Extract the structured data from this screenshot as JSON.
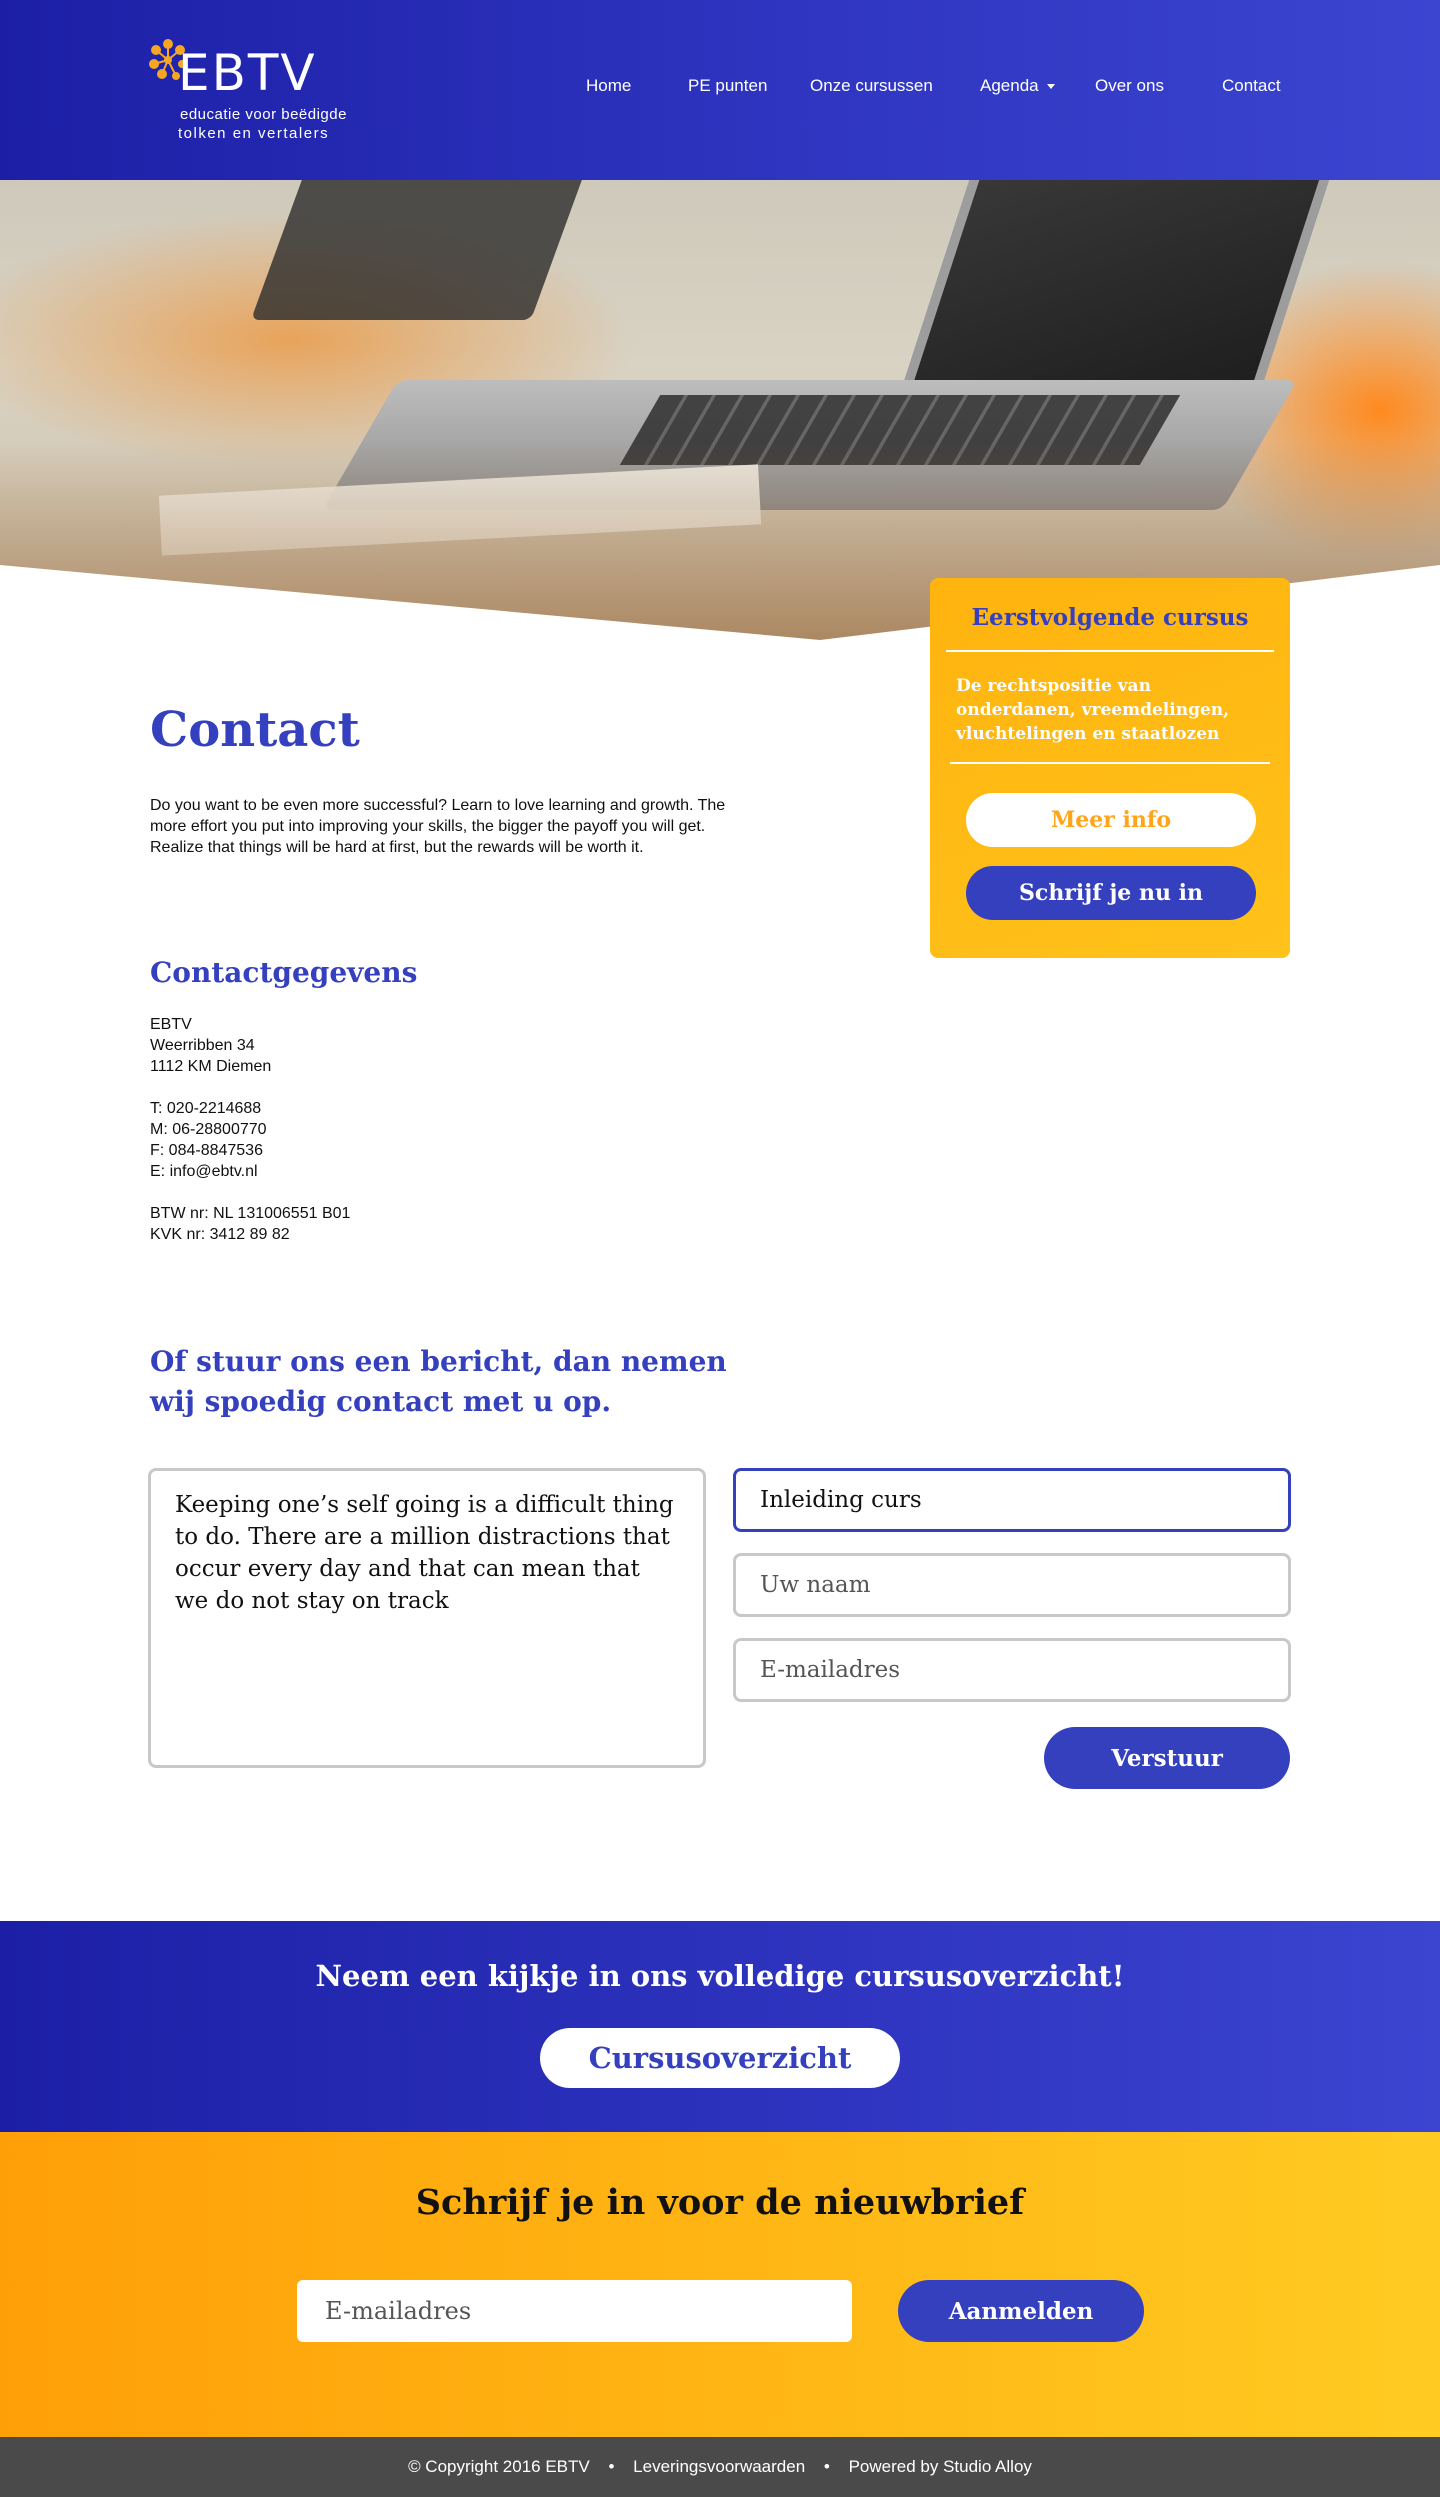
{
  "header": {
    "logo": {
      "word": "EBTV",
      "sub1": "educatie voor beëdigde",
      "sub2": "tolken en vertalers"
    },
    "nav": [
      {
        "label": "Home"
      },
      {
        "label": "PE punten"
      },
      {
        "label": "Onze cursussen"
      },
      {
        "label": "Agenda"
      },
      {
        "label": "Over ons"
      },
      {
        "label": "Contact"
      }
    ]
  },
  "main": {
    "title": "Contact",
    "intro": "Do you want to be even more successful? Learn to love learning and growth. The more effort you put into improving your skills, the bigger the payoff you will get. Realize that things will be hard at first, but the rewards will be worth it.",
    "contact_heading": "Contactgegevens",
    "contact": {
      "name": "EBTV",
      "street": "Weerribben 34",
      "city": "1112 KM  Diemen",
      "phone": "T: 020-2214688",
      "mobile": "M: 06-28800770",
      "fax": "F: 084-8847536",
      "email": "E: info@ebtv.nl",
      "vat": "BTW nr: NL 131006551 B01",
      "kvk": "KVK nr: 3412 89 82"
    },
    "form_heading": "Of stuur ons een bericht, dan nemen wij spoedig contact met u op."
  },
  "sidebar": {
    "title": "Eerstvolgende cursus",
    "course": "De rechtspositie van onderdanen, vreemdelingen, vluchtelingen en staatlozen",
    "info_label": "Meer info",
    "enroll_label": "Schrijf je nu in"
  },
  "form": {
    "message_value": "Keeping one’s self going is a difficult thing to do. There are a million distractions that occur every day and that can mean that we do not stay on track",
    "subject_value": "Inleiding curs",
    "name_placeholder": "Uw naam",
    "email_placeholder": "E-mailadres",
    "send_label": "Verstuur"
  },
  "cta": {
    "title": "Neem een kijkje in ons volledige cursusoverzicht!",
    "button_label": "Cursusoverzicht"
  },
  "newsletter": {
    "title": "Schrijf je in voor de nieuwbrief",
    "email_placeholder": "E-mailadres",
    "button_label": "Aanmelden"
  },
  "footer": {
    "copyright": "© Copyright  2016  EBTV",
    "terms": "Leveringsvoorwaarden",
    "powered": "Powered by Studio Alloy"
  },
  "colors": {
    "brand_blue": "#3440bd",
    "brand_orange": "#ffb30f",
    "footer_gray": "#4a4a4a"
  }
}
